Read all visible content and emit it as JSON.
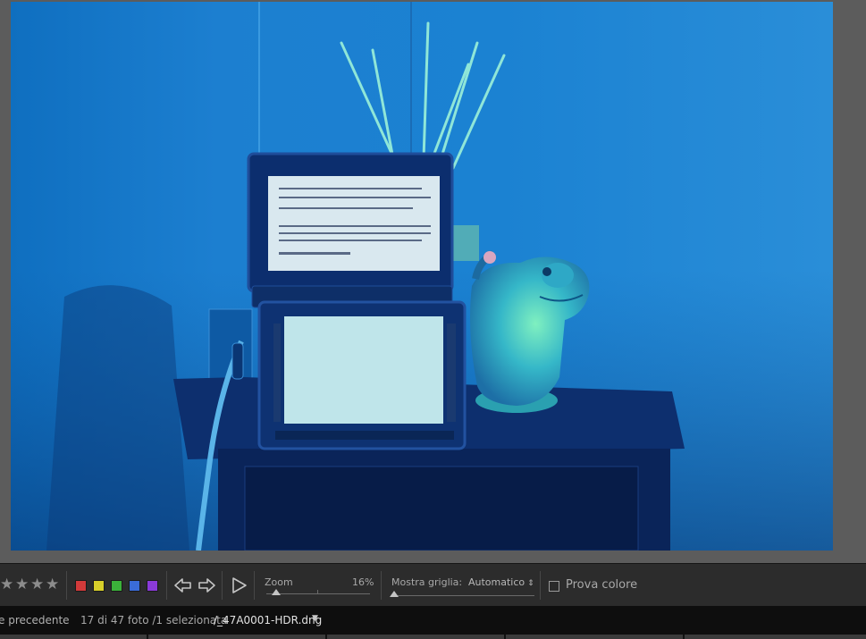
{
  "toolbar": {
    "stars": [
      "★",
      "★",
      "★",
      "★",
      "★"
    ],
    "color_labels": [
      {
        "name": "red",
        "color": "#d23a3a"
      },
      {
        "name": "yellow",
        "color": "#d8cf2a"
      },
      {
        "name": "green",
        "color": "#3bb23a"
      },
      {
        "name": "blue",
        "color": "#3a6cd8"
      },
      {
        "name": "purple",
        "color": "#8a3ad8"
      }
    ],
    "zoom_label": "Zoom",
    "zoom_value": "16%",
    "grid_label": "Mostra griglia:",
    "grid_value": "Automatico",
    "grid_select_icon": "⇕",
    "proof_label": "Prova colore"
  },
  "status": {
    "prev_label": "e precedente",
    "count": "17 di 47 foto",
    "selected": "/1 selezionata",
    "filename": "/_47A0001-HDR.dng",
    "filename_caret": "▼"
  },
  "accent": "#1d9bff"
}
